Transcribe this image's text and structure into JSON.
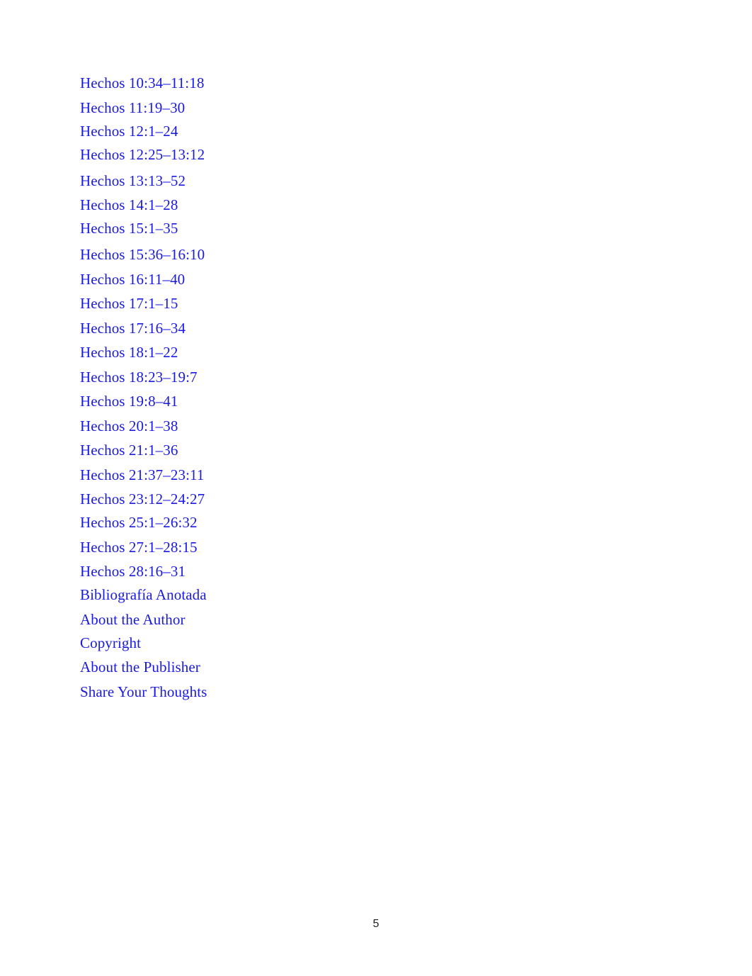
{
  "document": {
    "kind": "table-of-contents",
    "language": "es",
    "link_color": "#1a1ae0",
    "page_background": "#ffffff",
    "page_number_color": "#1f1f1f"
  },
  "toc": {
    "entries": [
      {
        "label": "Hechos 10:34–11:18",
        "spacing": "normal"
      },
      {
        "label": "Hechos 11:19–30",
        "spacing": "normal"
      },
      {
        "label": "Hechos 12:1–24",
        "spacing": "tight"
      },
      {
        "label": "Hechos 12:25–13:12",
        "spacing": "tight"
      },
      {
        "label": "Hechos 13:13–52",
        "spacing": "wide"
      },
      {
        "label": "Hechos 14:1–28",
        "spacing": "normal"
      },
      {
        "label": "Hechos 15:1–35",
        "spacing": "tight"
      },
      {
        "label": "Hechos 15:36–16:10",
        "spacing": "wide"
      },
      {
        "label": "Hechos 16:11–40",
        "spacing": "normal"
      },
      {
        "label": "Hechos 17:1–15",
        "spacing": "normal"
      },
      {
        "label": "Hechos 17:16–34",
        "spacing": "normal"
      },
      {
        "label": "Hechos 18:1–22",
        "spacing": "normal"
      },
      {
        "label": "Hechos 18:23–19:7",
        "spacing": "normal"
      },
      {
        "label": "Hechos 19:8–41",
        "spacing": "normal"
      },
      {
        "label": "Hechos 20:1–38",
        "spacing": "normal"
      },
      {
        "label": "Hechos 21:1–36",
        "spacing": "normal"
      },
      {
        "label": "Hechos 21:37–23:11",
        "spacing": "normal"
      },
      {
        "label": "Hechos 23:12–24:27",
        "spacing": "normal"
      },
      {
        "label": "Hechos 25:1–26:32",
        "spacing": "tight"
      },
      {
        "label": "Hechos 27:1–28:15",
        "spacing": "normal"
      },
      {
        "label": "Hechos 28:16–31",
        "spacing": "normal"
      },
      {
        "label": "Bibliografía Anotada",
        "spacing": "tight"
      },
      {
        "label": "About the Author",
        "spacing": "normal"
      },
      {
        "label": "Copyright",
        "spacing": "tight"
      },
      {
        "label": "About the Publisher",
        "spacing": "normal"
      },
      {
        "label": "Share Your Thoughts",
        "spacing": "normal"
      }
    ]
  },
  "footer": {
    "page_number": "5"
  }
}
